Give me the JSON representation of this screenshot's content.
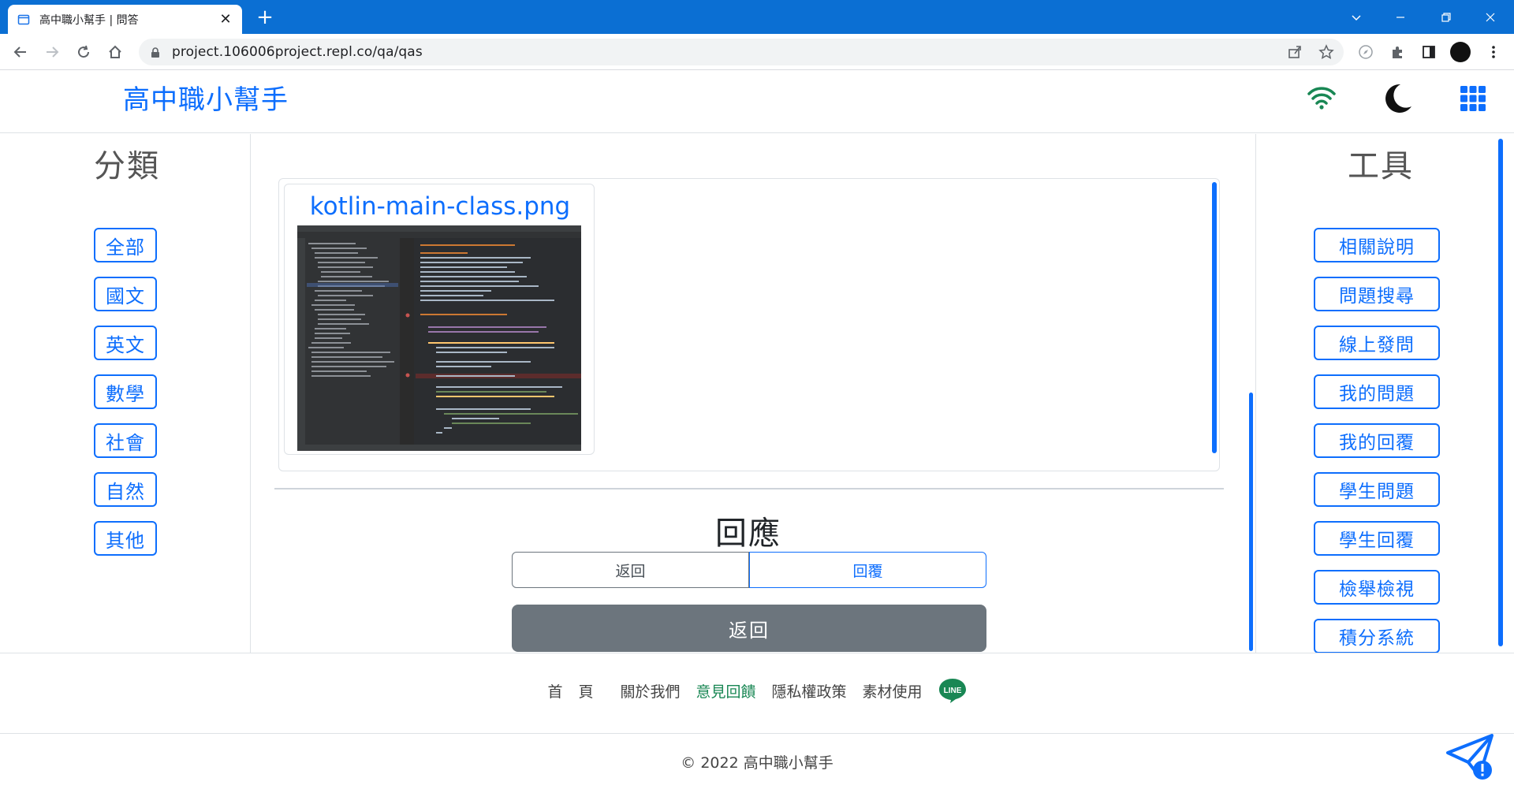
{
  "browser": {
    "tab_title": "高中職小幫手 | 問答",
    "tab_close": "✕",
    "new_tab": "+",
    "url": "project.106006project.repl.co/qa/qas"
  },
  "header": {
    "brand": "高中職小幫手"
  },
  "categories": {
    "heading": "分類",
    "items": [
      "全部",
      "國文",
      "英文",
      "數學",
      "社會",
      "自然",
      "其他"
    ]
  },
  "tools": {
    "heading": "工具",
    "items": [
      "相關說明",
      "問題搜尋",
      "線上發問",
      "我的問題",
      "我的回覆",
      "學生問題",
      "學生回覆",
      "檢舉檢視",
      "積分系統"
    ]
  },
  "attachment": {
    "filename": "kotlin-main-class.png"
  },
  "response": {
    "title": "回應",
    "back_label": "返回",
    "reply_label": "回覆",
    "back_big_label": "返回"
  },
  "footer": {
    "links": {
      "home": "首頁",
      "about": "關於我們",
      "feedback": "意見回饋",
      "privacy": "隱私權政策",
      "assets": "素材使用"
    },
    "line_text": "LINE",
    "copyright": "© 2022 高中職小幫手"
  },
  "colors": {
    "primary": "#0d6efd",
    "chrome_titlebar": "#0b6fd3",
    "secondary": "#6c757d",
    "success": "#198754"
  }
}
